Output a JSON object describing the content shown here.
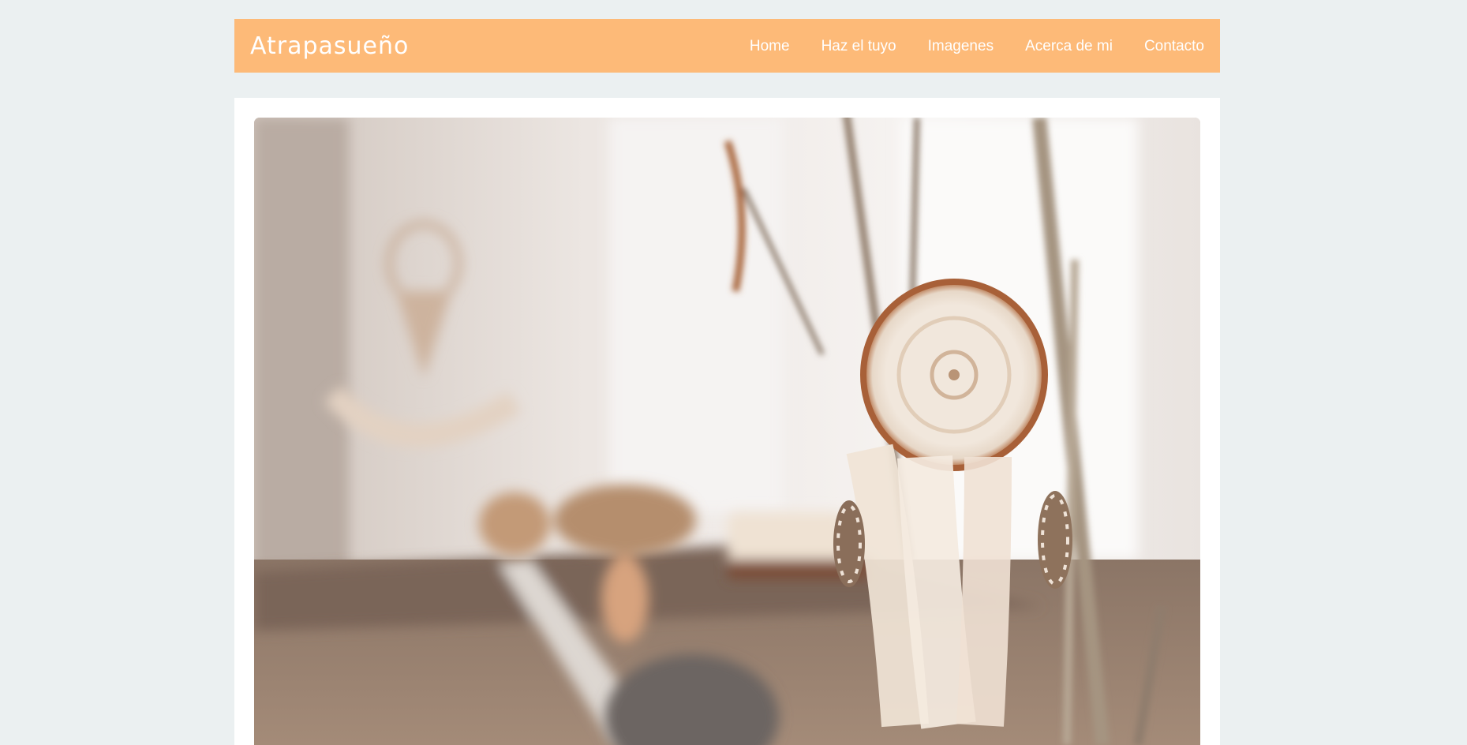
{
  "header": {
    "brand": "Atrapasueño",
    "nav": [
      {
        "label": "Home"
      },
      {
        "label": "Haz el tuyo"
      },
      {
        "label": "Imagenes"
      },
      {
        "label": "Acerca de mi"
      },
      {
        "label": "Contacto"
      }
    ]
  },
  "colors": {
    "page_background": "#ebf0f1",
    "navbar_background": "#fdba78",
    "nav_text": "#ffffff",
    "card_background": "#ffffff"
  },
  "hero": {
    "image": "dreamcatcher-photo"
  }
}
